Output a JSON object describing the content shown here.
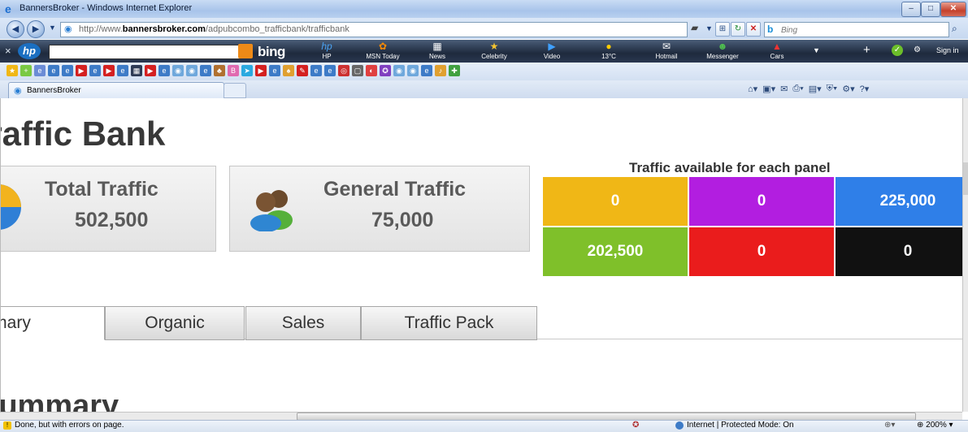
{
  "window": {
    "title": "BannersBroker - Windows Internet Explorer",
    "minimize": "–",
    "maximize": "□",
    "close": "✕"
  },
  "address": {
    "url_prefix": "http://www.",
    "url_domain": "bannersbroker.com",
    "url_path": "/adpubcombo_trafficbank/trafficbank"
  },
  "search": {
    "placeholder": "Bing"
  },
  "hp_toolbar": {
    "logo": "hp",
    "brand": "bing",
    "items": [
      {
        "label": "HP",
        "icon": "hp-icon"
      },
      {
        "label": "MSN Today",
        "icon": "msn-butterfly-icon"
      },
      {
        "label": "News",
        "icon": "news-icon"
      },
      {
        "label": "Celebrity",
        "icon": "star-icon"
      },
      {
        "label": "Video",
        "icon": "play-icon"
      },
      {
        "label": "13°C",
        "icon": "sun-icon"
      },
      {
        "label": "Hotmail",
        "icon": "mail-icon"
      },
      {
        "label": "Messenger",
        "icon": "messenger-icon"
      },
      {
        "label": "Cars",
        "icon": "car-icon"
      }
    ],
    "sign_in": "Sign in"
  },
  "tab": {
    "title": "BannersBroker"
  },
  "page": {
    "title": "Traffic Bank",
    "stats": [
      {
        "label": "Total Traffic",
        "value": "502,500"
      },
      {
        "label": "General Traffic",
        "value": "75,000"
      }
    ],
    "panel_caption": "Traffic available for each panel",
    "panels": [
      {
        "value": "0",
        "color": "#f0b716"
      },
      {
        "value": "0",
        "color": "#b21ee0"
      },
      {
        "value": "225,000",
        "color": "#2f7fe8"
      },
      {
        "value": "202,500",
        "color": "#7fc02a"
      },
      {
        "value": "0",
        "color": "#ea1c1c"
      },
      {
        "value": "0",
        "color": "#111111"
      }
    ],
    "tabs": [
      "Summary",
      "Organic",
      "Sales",
      "Traffic Pack"
    ],
    "summary_heading": "Summary"
  },
  "status": {
    "text": "Done, but with errors on page.",
    "zone": "Internet | Protected Mode: On",
    "zoom": "200%"
  }
}
